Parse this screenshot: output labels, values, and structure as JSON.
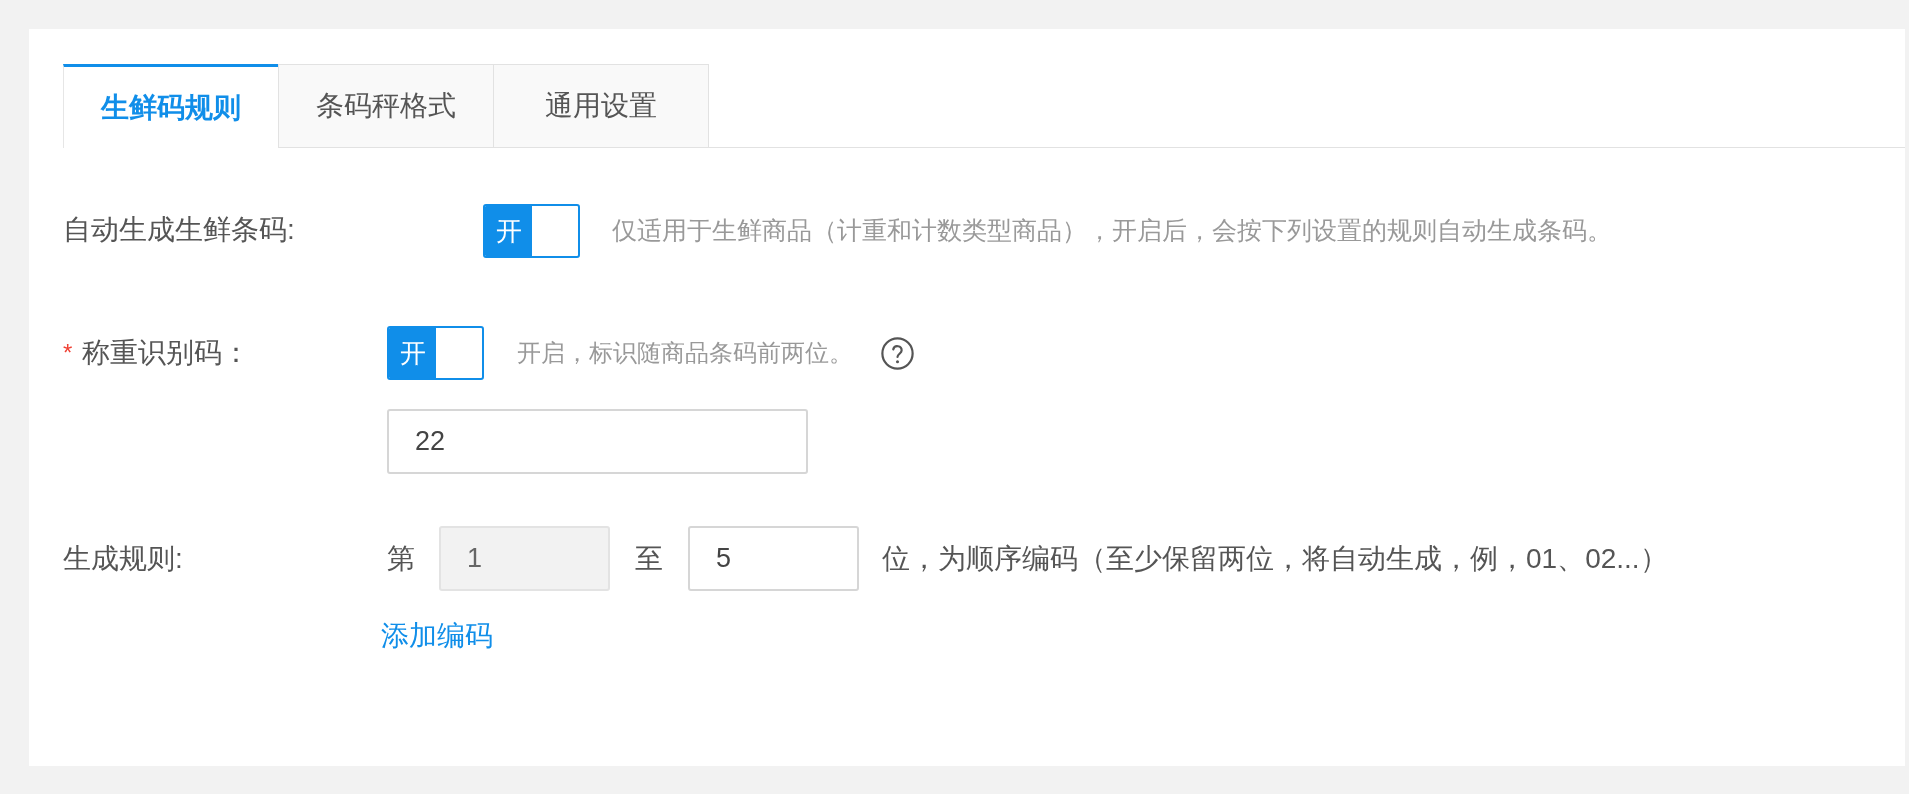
{
  "tabs": [
    {
      "label": "生鲜码规则",
      "selected": true
    },
    {
      "label": "条码秤格式",
      "selected": false
    },
    {
      "label": "通用设置",
      "selected": false
    }
  ],
  "auto_barcode": {
    "label": "自动生成生鲜条码:",
    "switch": {
      "text": "开",
      "on": true
    },
    "hint": "仅适用于生鲜商品（计重和计数类型商品），开启后，会按下列设置的规则自动生成条码。"
  },
  "weighing_code": {
    "required_mark": "*",
    "label": "称重识别码：",
    "switch": {
      "text": "开",
      "on": true
    },
    "hint": "开启，标识随商品条码前两位。",
    "value": "22"
  },
  "generation_rule": {
    "label": "生成规则:",
    "from_label": "第",
    "from": {
      "value": "1",
      "disabled": true
    },
    "to_label": "至",
    "to": {
      "value": "5",
      "disabled": false
    },
    "hint": "位，为顺序编码（至少保留两位，将自动生成，例，01、02...）",
    "add_link": "添加编码"
  }
}
